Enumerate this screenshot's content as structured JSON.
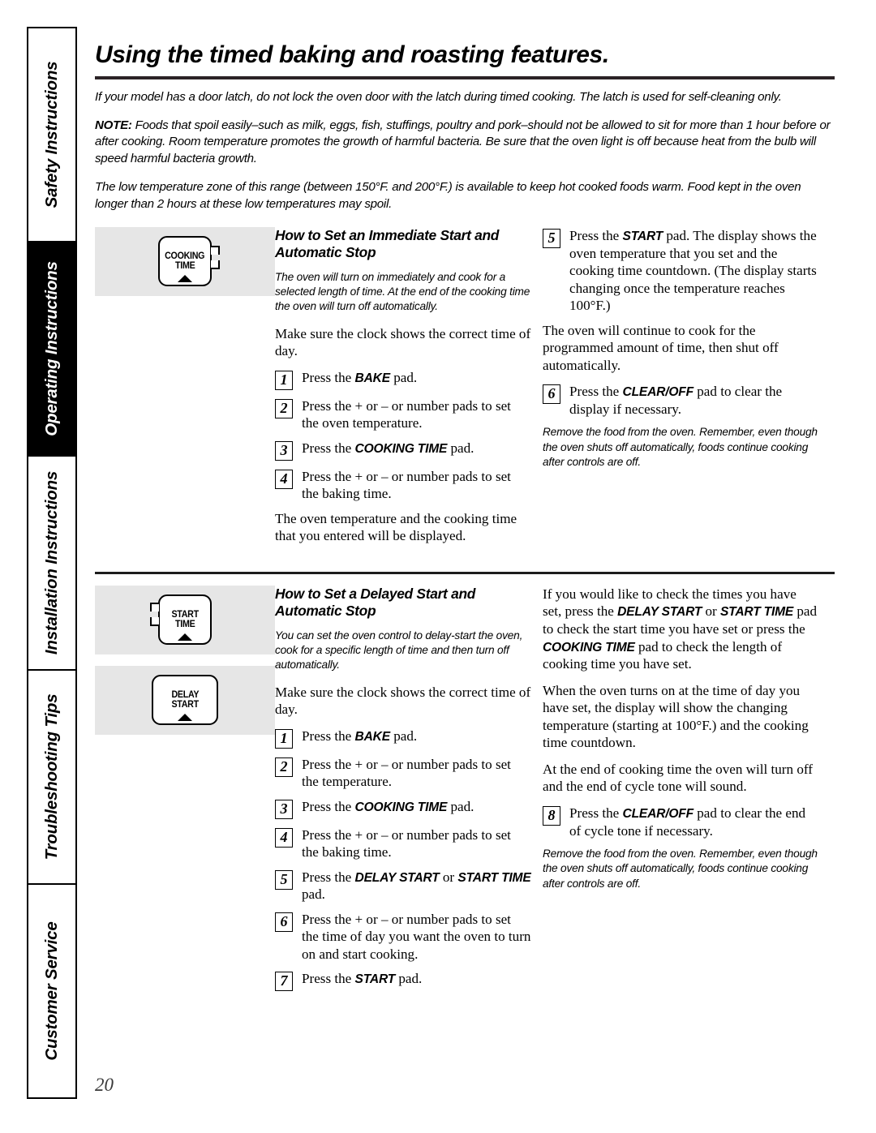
{
  "sidebar": {
    "tabs": [
      {
        "label": "Safety Instructions",
        "active": false
      },
      {
        "label": "Operating Instructions",
        "active": true
      },
      {
        "label": "Installation Instructions",
        "active": false
      },
      {
        "label": "Troubleshooting Tips",
        "active": false
      },
      {
        "label": "Customer Service",
        "active": false
      }
    ]
  },
  "page": {
    "title": "Using the timed baking and roasting features.",
    "number": "20",
    "intro_1": "If your model has a door latch, do not lock the oven door with the latch during timed cooking. The latch is used for self-cleaning only.",
    "note_label": "NOTE:",
    "note_body": " Foods that spoil easily–such as milk, eggs, fish, stuffings, poultry and pork–should not be allowed to sit for more than 1 hour before or after cooking. Room temperature promotes the growth of harmful bacteria. Be sure that the oven light is off because heat from the bulb will speed harmful bacteria growth.",
    "intro_3": "The low temperature zone of this range (between 150°F. and 200°F.) is available to keep hot cooked foods warm. Food kept in the oven longer than 2 hours at these low temperatures may spoil."
  },
  "section1": {
    "heading": "How to Set an Immediate Start and Automatic Stop",
    "pad": {
      "line1": "COOKING",
      "line2": "TIME",
      "brackets": "right"
    },
    "intro": "The oven will turn on immediately and cook for a selected length of time. At the end of the cooking time the oven will turn off automatically.",
    "pre_step_text": "Make sure the clock shows the correct time of day.",
    "steps": [
      {
        "num": "1",
        "pre": "Press the ",
        "bold": "BAKE",
        "post": " pad."
      },
      {
        "num": "2",
        "pre": "Press the + or – or number pads to set the oven temperature.",
        "bold": "",
        "post": ""
      },
      {
        "num": "3",
        "pre": "Press the ",
        "bold": "COOKING TIME",
        "post": " pad."
      },
      {
        "num": "4",
        "pre": "Press the + or – or number pads to set the baking time.",
        "bold": "",
        "post": ""
      }
    ],
    "after_steps": "The oven temperature and the cooking time that you entered will be displayed.",
    "right_steps": [
      {
        "num": "5",
        "pre": "Press the ",
        "bold": "START",
        "post": " pad. The display shows the oven temperature that you set and the cooking time countdown. (The display starts changing once the temperature reaches 100°F.)"
      },
      {
        "num": "6",
        "pre": "Press the ",
        "bold": "CLEAR/OFF",
        "post": " pad to clear the display if necessary."
      }
    ],
    "right_mid_text": "The oven will continue to cook for the programmed amount of time, then shut off automatically.",
    "right_note": "Remove the food from the oven. Remember, even though the oven shuts off automatically, foods continue cooking after controls are off."
  },
  "section2": {
    "heading": "How to Set a Delayed Start and Automatic Stop",
    "pads": [
      {
        "line1": "START",
        "line2": "TIME",
        "brackets": "left"
      },
      {
        "line1": "DELAY",
        "line2": "START",
        "brackets": "none"
      }
    ],
    "intro": "You can set the oven control to delay-start the oven, cook for a specific length of time and then turn off automatically.",
    "pre_step_text": "Make sure the clock shows the correct time of day.",
    "steps": [
      {
        "num": "1",
        "pre": "Press the ",
        "bold": "BAKE",
        "post": " pad."
      },
      {
        "num": "2",
        "pre": "Press the + or – or number pads to set the temperature.",
        "bold": "",
        "post": ""
      },
      {
        "num": "3",
        "pre": "Press the ",
        "bold": "COOKING TIME",
        "post": " pad."
      },
      {
        "num": "4",
        "pre": "Press the + or – or number pads to set the baking time.",
        "bold": "",
        "post": ""
      },
      {
        "num": "5",
        "pre": "Press the ",
        "bold": "DELAY START",
        "mid": " or ",
        "bold2": "START TIME",
        "post": " pad."
      },
      {
        "num": "6",
        "pre": "Press the + or – or number pads to set the time of day you want the oven to turn on and start cooking.",
        "bold": "",
        "post": ""
      },
      {
        "num": "7",
        "pre": "Press the ",
        "bold": "START",
        "post": " pad."
      }
    ],
    "right_p1_a": "If you would like to check the times you have set, press the ",
    "right_p1_b1": "DELAY START",
    "right_p1_c": " or ",
    "right_p1_b2": "START TIME",
    "right_p1_d": " pad to check the start time you have set or press the ",
    "right_p1_b3": "COOKING TIME",
    "right_p1_e": " pad to check the length of cooking time you have set.",
    "right_p2": "When the oven turns on at the time of day you have set, the display will show the changing temperature (starting at 100°F.) and the cooking time countdown.",
    "right_p3": "At the end of cooking time the oven will turn off and the end of cycle tone will sound.",
    "right_step8": {
      "num": "8",
      "pre": "Press the ",
      "bold": "CLEAR/OFF",
      "post": " pad to clear the end of cycle tone if necessary."
    },
    "right_note": "Remove the food from the oven. Remember, even though the oven shuts off automatically, foods continue cooking after controls are off."
  }
}
